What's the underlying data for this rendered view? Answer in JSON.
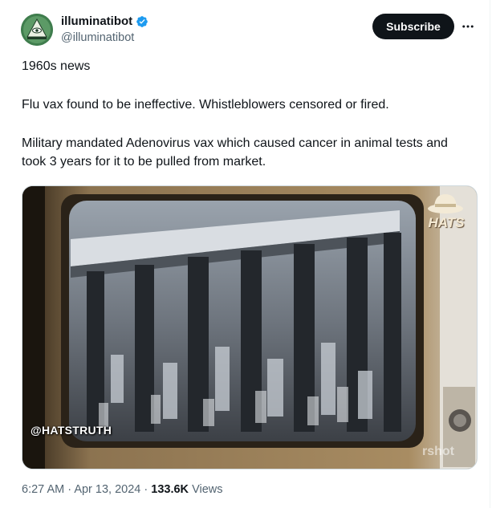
{
  "author": {
    "name": "illuminatibot",
    "handle": "@illuminatibot",
    "verified": true,
    "avatar_icon": "eye-pyramid-icon"
  },
  "actions": {
    "subscribe_label": "Subscribe",
    "more_icon": "more-horizontal-icon"
  },
  "tweet": {
    "paragraphs": [
      "1960s news",
      "Flu vax found to be ineffective. Whistleblowers censored or fired.",
      "Military mandated Adenovirus vax which caused cancer in animal tests and took 3 years for it to be pulled from market."
    ]
  },
  "media": {
    "overlay_tag": "@HATSTRUTH",
    "brand_text": "HATS",
    "corner_watermark": "rshot"
  },
  "meta": {
    "time": "6:27 AM",
    "separator": "·",
    "date": "Apr 13, 2024",
    "views_count": "133.6K",
    "views_label": "Views"
  },
  "colors": {
    "text_primary": "#0f1419",
    "text_secondary": "#536471",
    "verified_blue": "#1d9bf0",
    "button_bg": "#0f1419"
  }
}
